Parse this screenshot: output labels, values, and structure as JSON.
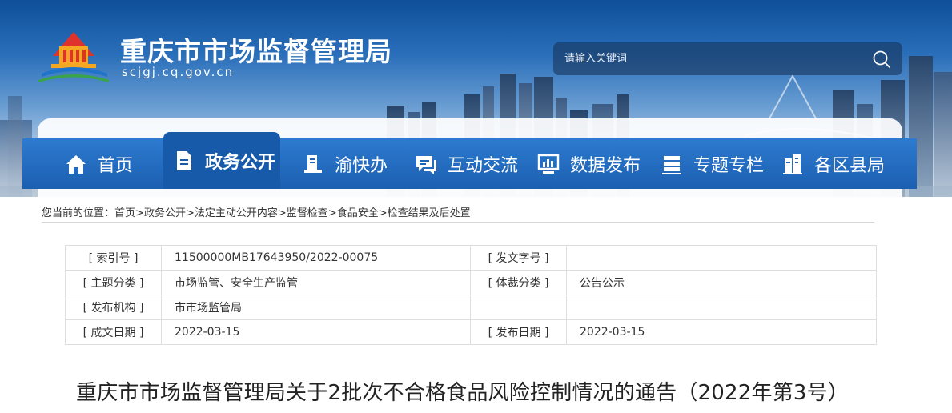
{
  "site": {
    "title": "重庆市市场监督管理局",
    "domain": "scjgj.cq.gov.cn"
  },
  "search": {
    "placeholder": "请输入关键词",
    "icon": "search-icon"
  },
  "nav": {
    "items": [
      {
        "label": "首页",
        "icon": "home-icon",
        "active": false
      },
      {
        "label": "政务公开",
        "icon": "document-icon",
        "active": true
      },
      {
        "label": "渝快办",
        "icon": "service-icon",
        "active": false
      },
      {
        "label": "互动交流",
        "icon": "chat-icon",
        "active": false
      },
      {
        "label": "数据发布",
        "icon": "chart-monitor-icon",
        "active": false
      },
      {
        "label": "专题专栏",
        "icon": "stack-icon",
        "active": false
      },
      {
        "label": "各区县局",
        "icon": "buildings-icon",
        "active": false
      }
    ]
  },
  "breadcrumb": {
    "prefix": "您当前的位置：",
    "items": [
      "首页",
      "政务公开",
      "法定主动公开内容",
      "监督检查",
      "食品安全",
      "检查结果及后处置"
    ],
    "separator": ">"
  },
  "meta": {
    "rows": [
      {
        "k1": "[ 索引号 ]",
        "v1": "11500000MB17643950/2022-00075",
        "k2": "[ 发文字号 ]",
        "v2": ""
      },
      {
        "k1": "[ 主题分类 ]",
        "v1": "市场监管、安全生产监管",
        "k2": "[ 体裁分类 ]",
        "v2": "公告公示"
      },
      {
        "k1": "[ 发布机构 ]",
        "v1": "市市场监管局",
        "k2": "",
        "v2": ""
      },
      {
        "k1": "[ 成文日期 ]",
        "v1": "2022-03-15",
        "k2": "[ 发布日期 ]",
        "v2": "2022-03-15"
      }
    ]
  },
  "article": {
    "title": "重庆市市场监督管理局关于2批次不合格食品风险控制情况的通告（2022年第3号）"
  },
  "colors": {
    "nav_bar": "#1f63b5",
    "nav_active": "#175aa9",
    "banner_top": "#0f4f99",
    "logo_red": "#e0322c",
    "logo_orange": "#f5a623",
    "logo_blue": "#1f73c9",
    "logo_green": "#3aa44a"
  }
}
